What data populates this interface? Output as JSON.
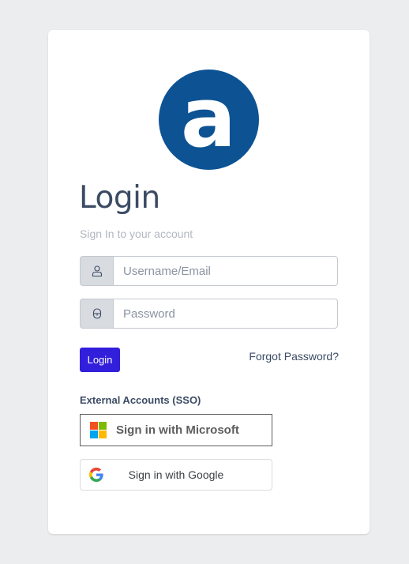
{
  "logo": {
    "letter": "a",
    "color": "#0d5394"
  },
  "title": "Login",
  "subtitle": "Sign In to your account",
  "username": {
    "placeholder": "Username/Email",
    "icon": "user-icon"
  },
  "password": {
    "placeholder": "Password",
    "icon": "lock-icon"
  },
  "actions": {
    "login_label": "Login",
    "forgot_label": "Forgot Password?"
  },
  "sso": {
    "heading": "External Accounts (SSO)",
    "microsoft_label": "Sign in with Microsoft",
    "google_label": "Sign in with Google"
  },
  "colors": {
    "primary": "#321fdb",
    "text": "#3c4b64",
    "muted": "#b1b7c1",
    "page_bg": "#ebedef"
  }
}
